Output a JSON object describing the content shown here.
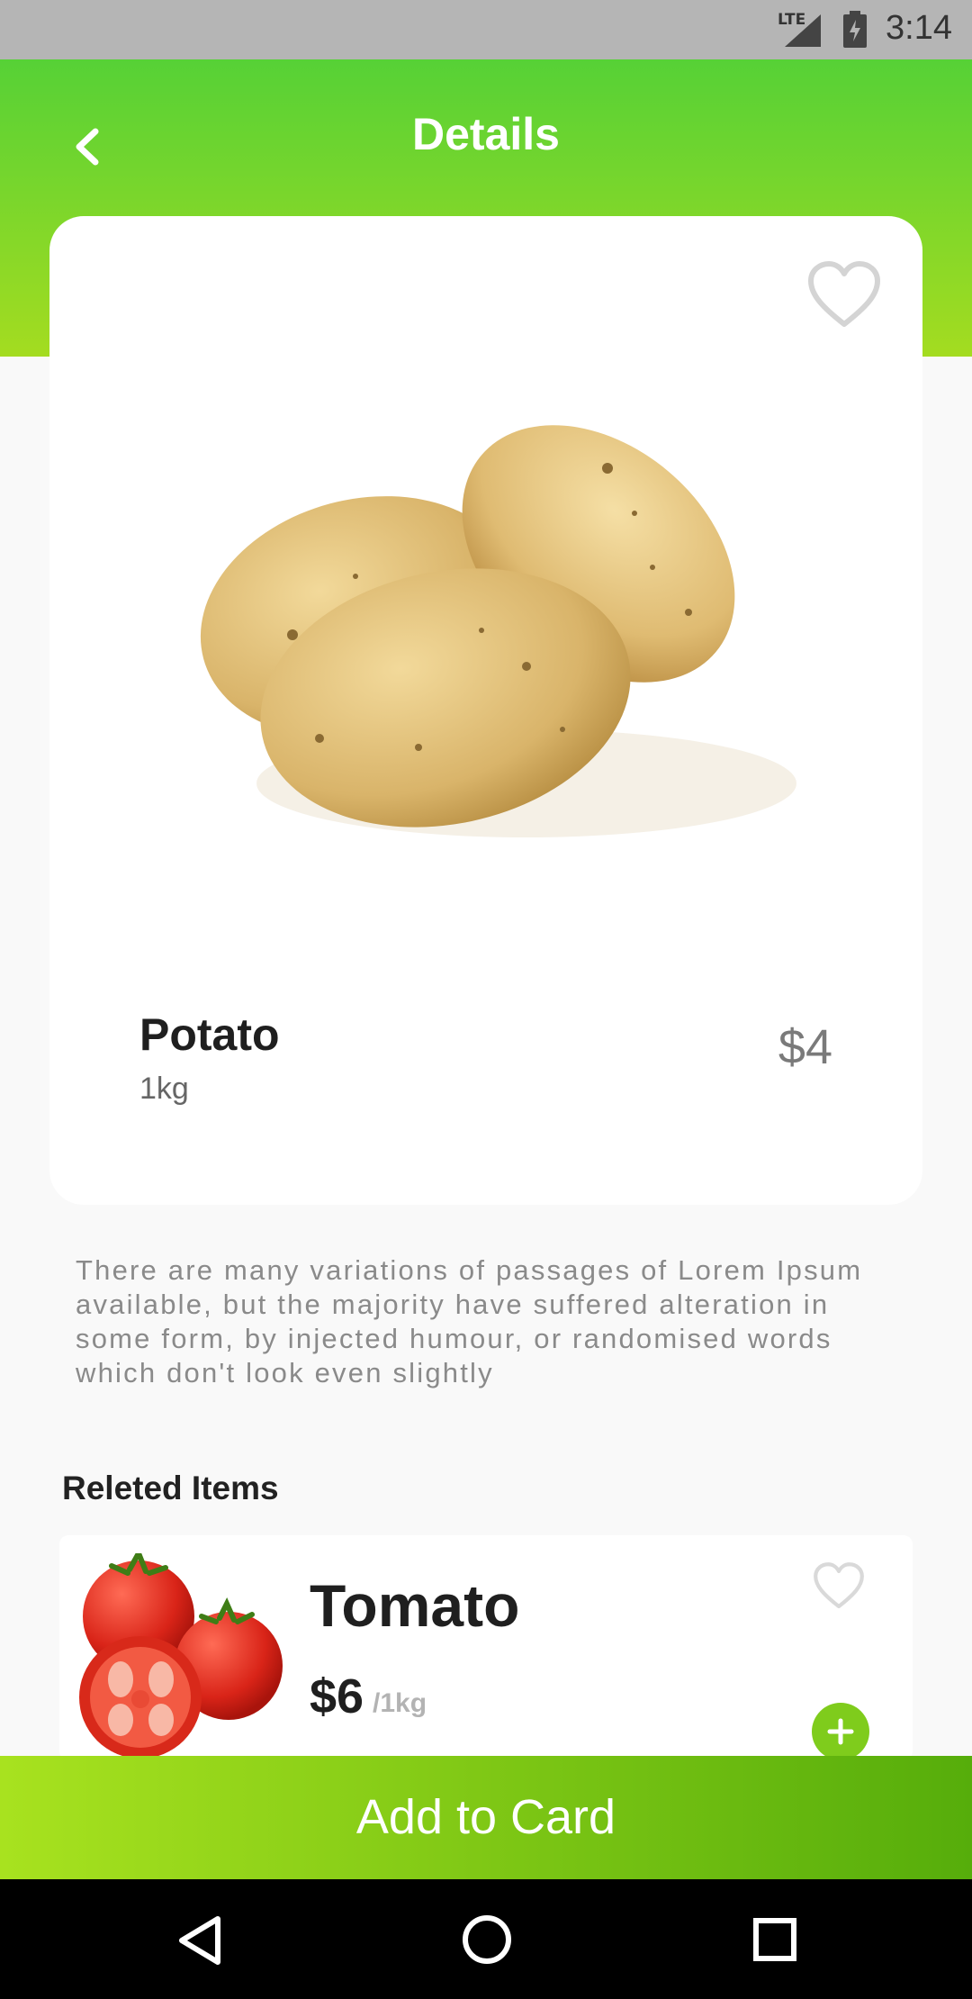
{
  "status_bar": {
    "network": "LTE",
    "time": "3:14"
  },
  "header": {
    "title": "Details"
  },
  "product": {
    "name": "Potato",
    "weight": "1kg",
    "price": "$4",
    "favorited": false
  },
  "description": "There are many variations of passages of Lorem Ipsum available, but the majority have suffered alteration in some form, by injected humour, or randomised words which don't look even slightly",
  "related": {
    "heading": "Releted Items",
    "items": [
      {
        "name": "Tomato",
        "price": "$6",
        "unit": "/1kg",
        "favorited": false
      }
    ]
  },
  "cta": {
    "label": "Add to Card"
  },
  "colors": {
    "accent": "#7fcc1c",
    "header_top": "#56d136",
    "header_bottom": "#a4dc20"
  },
  "icons": [
    "back-arrow-icon",
    "heart-outline-icon",
    "plus-icon",
    "signal-icon",
    "battery-icon",
    "nav-back-icon",
    "nav-home-icon",
    "nav-recents-icon"
  ]
}
